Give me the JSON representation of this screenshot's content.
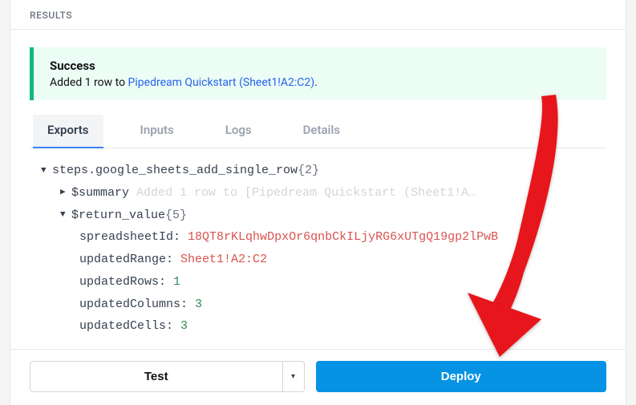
{
  "header": {
    "title": "RESULTS"
  },
  "banner": {
    "title": "Success",
    "message_prefix": "Added 1 row to ",
    "link_text": "Pipedream Quickstart (Sheet1!A2:C2)",
    "message_suffix": "."
  },
  "tabs": {
    "exports": "Exports",
    "inputs": "Inputs",
    "logs": "Logs",
    "details": "Details"
  },
  "tree": {
    "root_label": "steps.google_sheets_add_single_row ",
    "root_count": "{2}",
    "summary_key": "$summary",
    "summary_preview": "Added 1 row to [Pipedream Quickstart (Sheet1!A…",
    "return_key": "$return_value ",
    "return_count": "{5}",
    "items": [
      {
        "key": "spreadsheetId:",
        "value": "18QT8rKLqhwDpxOr6qnbCkILjyRG6xUTgQ19gp2lPwB",
        "type": "str"
      },
      {
        "key": "updatedRange:",
        "value": "Sheet1!A2:C2",
        "type": "str"
      },
      {
        "key": "updatedRows:",
        "value": "1",
        "type": "num"
      },
      {
        "key": "updatedColumns:",
        "value": "3",
        "type": "num"
      },
      {
        "key": "updatedCells:",
        "value": "3",
        "type": "num"
      }
    ]
  },
  "buttons": {
    "test": "Test",
    "deploy": "Deploy"
  }
}
